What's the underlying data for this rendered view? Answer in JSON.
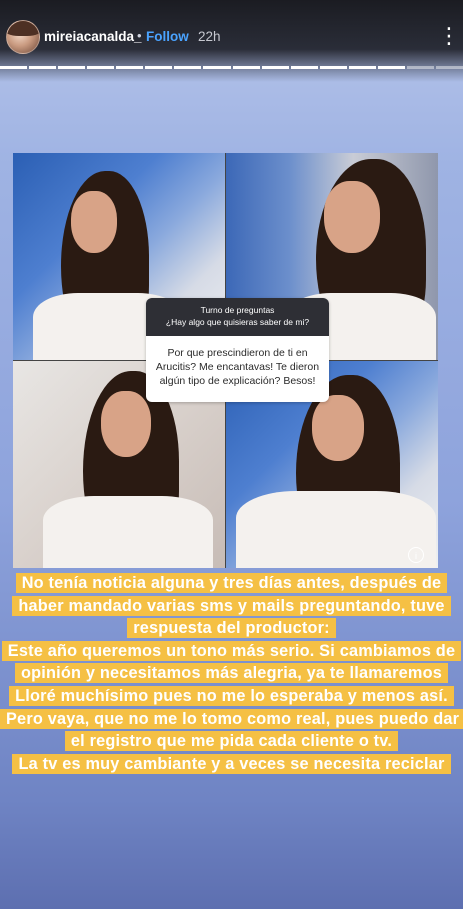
{
  "header": {
    "username": "mireiacanalda_",
    "separator": "•",
    "follow_label": "Follow",
    "time": "22h",
    "more_icon": "more-vertical-icon",
    "progress": {
      "total_segments": 16,
      "completed_segments": 14
    }
  },
  "question_card": {
    "title": "Turno de preguntas",
    "subtitle": "¿Hay algo que quisieras saber de mi?",
    "answer": "Por que prescindieron de ti en Arucitis? Me encantavas! Te dieron algún tipo de explicación? Besos!"
  },
  "info_icon": "i",
  "caption": {
    "p1": "No tenía noticia alguna y tres días antes, después de haber mandado varias sms y mails preguntando, tuve respuesta del productor:",
    "p2": "Este año queremos un tono más serio. Si cambiamos de opinión y necesitamos más alegria, ya te llamaremos",
    "p3": "Lloré muchísimo pues no me lo esperaba y menos así.",
    "p4": "Pero vaya, que no me lo tomo como real, pues puedo dar el registro que me pida cada cliente o tv.",
    "p5": "La tv es muy cambiante y a veces se necesita reciclar"
  },
  "colors": {
    "follow": "#4aa3ff",
    "highlight": "#f5c044",
    "background_top": "#b7c5ea",
    "background_bottom": "#5d6fb0"
  }
}
